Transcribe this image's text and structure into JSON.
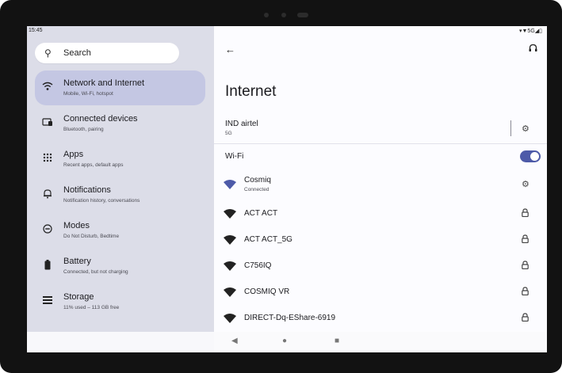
{
  "status": {
    "time": "15:45",
    "icons": "▾▼5G◢▯"
  },
  "sidebar": {
    "search_label": "Search",
    "items": [
      {
        "label": "Network and Internet",
        "sub": "Mobile, Wi-Fi, hotspot",
        "icon": "wifi-icon"
      },
      {
        "label": "Connected devices",
        "sub": "Bluetooth, pairing",
        "icon": "devices-icon"
      },
      {
        "label": "Apps",
        "sub": "Recent apps, default apps",
        "icon": "apps-grid-icon"
      },
      {
        "label": "Notifications",
        "sub": "Notification history, conversations",
        "icon": "bell-icon"
      },
      {
        "label": "Modes",
        "sub": "Do Not Disturb, Bedtime",
        "icon": "modes-icon"
      },
      {
        "label": "Battery",
        "sub": "Connected, but not charging",
        "icon": "battery-icon"
      },
      {
        "label": "Storage",
        "sub": "11% used – 113 GB free",
        "icon": "storage-icon"
      }
    ]
  },
  "main": {
    "title": "Internet",
    "carrier": {
      "name": "IND airtel",
      "sub": "5G"
    },
    "wifi_label": "Wi-Fi",
    "wifi_enabled": true,
    "networks": [
      {
        "name": "Cosmiq",
        "sub": "Connected",
        "action": "gear-icon"
      },
      {
        "name": "ACT ACT",
        "sub": "",
        "action": "lock-icon"
      },
      {
        "name": "ACT ACT_5G",
        "sub": "",
        "action": "lock-icon"
      },
      {
        "name": "C756IQ",
        "sub": "",
        "action": "lock-icon"
      },
      {
        "name": "COSMIQ VR",
        "sub": "",
        "action": "lock-icon"
      },
      {
        "name": "DIRECT-Dq-EShare-6919",
        "sub": "",
        "action": "lock-icon"
      }
    ]
  },
  "colors": {
    "accent": "#4d5aa8",
    "sidebar_bg": "#dcdde8",
    "active_bg": "#c4c7e3"
  }
}
